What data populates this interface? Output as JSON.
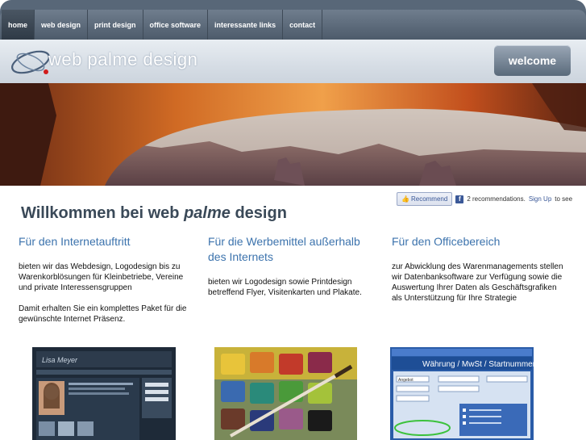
{
  "nav": {
    "items": [
      {
        "label": "home",
        "active": true
      },
      {
        "label": "web design",
        "active": false
      },
      {
        "label": "print design",
        "active": false
      },
      {
        "label": "office software",
        "active": false
      },
      {
        "label": "interessante links",
        "active": false
      },
      {
        "label": "contact",
        "active": false
      }
    ]
  },
  "header": {
    "logo_words": [
      "web",
      "palme",
      "design"
    ],
    "welcome_label": "welcome",
    "logo_icon": "orbit-logo-icon"
  },
  "facebook": {
    "recommend_label": "Recommend",
    "count_text": "2 recommendations.",
    "signup_link": "Sign Up",
    "signup_suffix": "to see"
  },
  "main": {
    "title_pre": "Willkommen bei web ",
    "title_em": "palme",
    "title_post": " design",
    "columns": [
      {
        "heading": "Für den Internetauftritt",
        "paragraphs": [
          "bieten wir das Webdesign, Logodesign bis zu Warenkorblösungen für Kleinbetriebe, Vereine und private Interessensgruppen",
          "Damit erhalten Sie ein komplettes Paket für die gewünschte Internet Präsenz."
        ]
      },
      {
        "heading": "Für die Werbemittel außerhalb des Internets",
        "paragraphs": [
          "bieten wir Logodesign sowie Printdesign betreffend Flyer, Visitenkarten und Plakate."
        ]
      },
      {
        "heading": "Für den Officebereich",
        "paragraphs": [
          "zur Abwicklung des Warenmanagements stellen wir Datenbanksoftware zur Verfügung sowie die Auswertung Ihrer Daten als Geschäftsgrafiken als Unterstützung für Ihre Strategie"
        ]
      }
    ]
  },
  "thumbnails": {
    "web_screenshot_text": "Lisa Meyer",
    "office_window_title": "Währung / MwSt / Startnummern",
    "app_label": "Angebot"
  },
  "colors": {
    "nav_bg": "#586778",
    "heading_blue": "#3c73ad",
    "title_gray": "#3a4958",
    "facebook_blue": "#3b5998"
  }
}
